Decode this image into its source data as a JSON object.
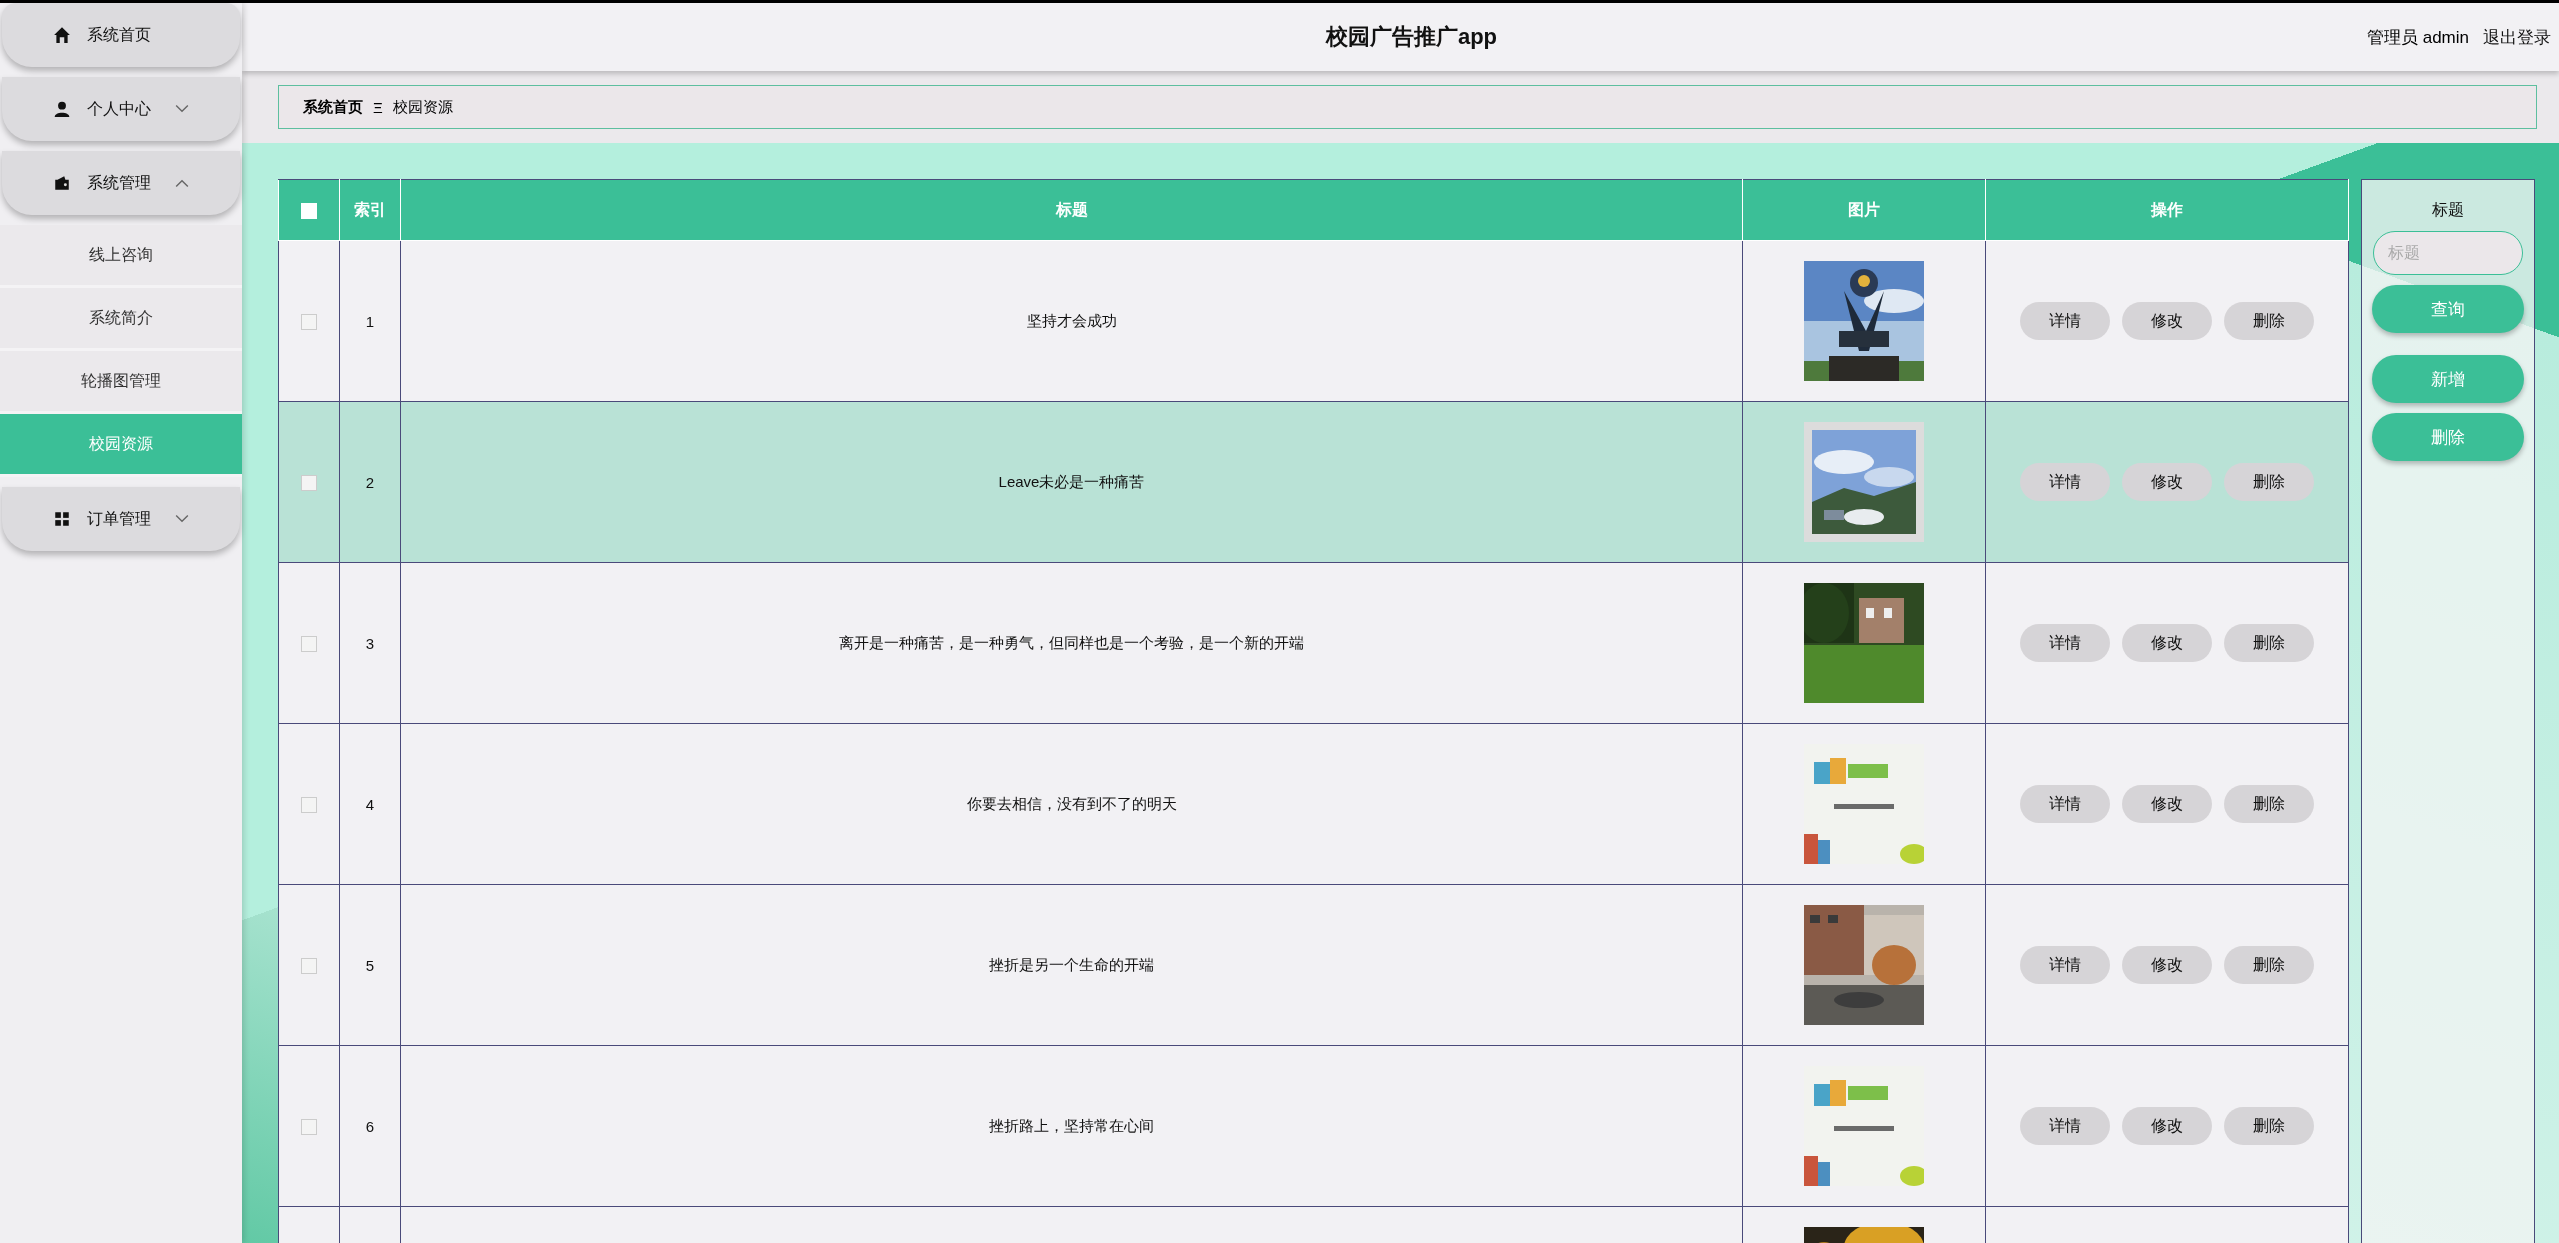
{
  "sidebar": {
    "items": [
      {
        "label": "系统首页"
      },
      {
        "label": "个人中心",
        "expanded": false
      },
      {
        "label": "系统管理",
        "expanded": true,
        "children": [
          {
            "label": "线上咨询",
            "selected": false
          },
          {
            "label": "系统简介",
            "selected": false
          },
          {
            "label": "轮播图管理",
            "selected": false
          },
          {
            "label": "校园资源",
            "selected": true
          }
        ]
      },
      {
        "label": "订单管理",
        "expanded": false
      }
    ]
  },
  "header": {
    "title": "校园广告推广app",
    "user": "管理员 admin",
    "logout": "退出登录"
  },
  "breadcrumb": {
    "items": [
      "系统首页",
      "校园资源"
    ],
    "separator": "Ξ"
  },
  "table": {
    "select_all": {
      "checked": false
    },
    "columns": [
      "索引",
      "标题",
      "图片",
      "操作"
    ],
    "rows": [
      {
        "checked": false,
        "highlighted": false,
        "index": "1",
        "title": "坚持才会成功",
        "picture": {
          "kind": "picture"
        },
        "actions": [
          "详情",
          "修改",
          "删除"
        ]
      },
      {
        "checked": false,
        "highlighted": true,
        "index": "2",
        "title": "Leave未必是一种痛苦",
        "picture": {
          "kind": "picture"
        },
        "actions": [
          "详情",
          "修改",
          "删除"
        ]
      },
      {
        "checked": false,
        "highlighted": false,
        "index": "3",
        "title": "离开是一种痛苦，是一种勇气，但同样也是一个考验，是一个新的开端",
        "picture": {
          "kind": "picture"
        },
        "actions": [
          "详情",
          "修改",
          "删除"
        ]
      },
      {
        "checked": false,
        "highlighted": false,
        "index": "4",
        "title": "你要去相信，没有到不了的明天",
        "picture": {
          "kind": "picture"
        },
        "actions": [
          "详情",
          "修改",
          "删除"
        ]
      },
      {
        "checked": false,
        "highlighted": false,
        "index": "5",
        "title": "挫折是另一个生命的开端",
        "picture": {
          "kind": "picture"
        },
        "actions": [
          "详情",
          "修改",
          "删除"
        ]
      },
      {
        "checked": false,
        "highlighted": false,
        "index": "6",
        "title": "挫折路上，坚持常在心间",
        "picture": {
          "kind": "picture"
        },
        "actions": [
          "详情",
          "修改",
          "删除"
        ]
      },
      {
        "highlighted": false,
        "picture": {
          "kind": "picture"
        }
      }
    ]
  },
  "search_panel": {
    "label": "标题",
    "placeholder": "标题",
    "buttons": [
      "查询",
      "新增",
      "删除"
    ]
  }
}
